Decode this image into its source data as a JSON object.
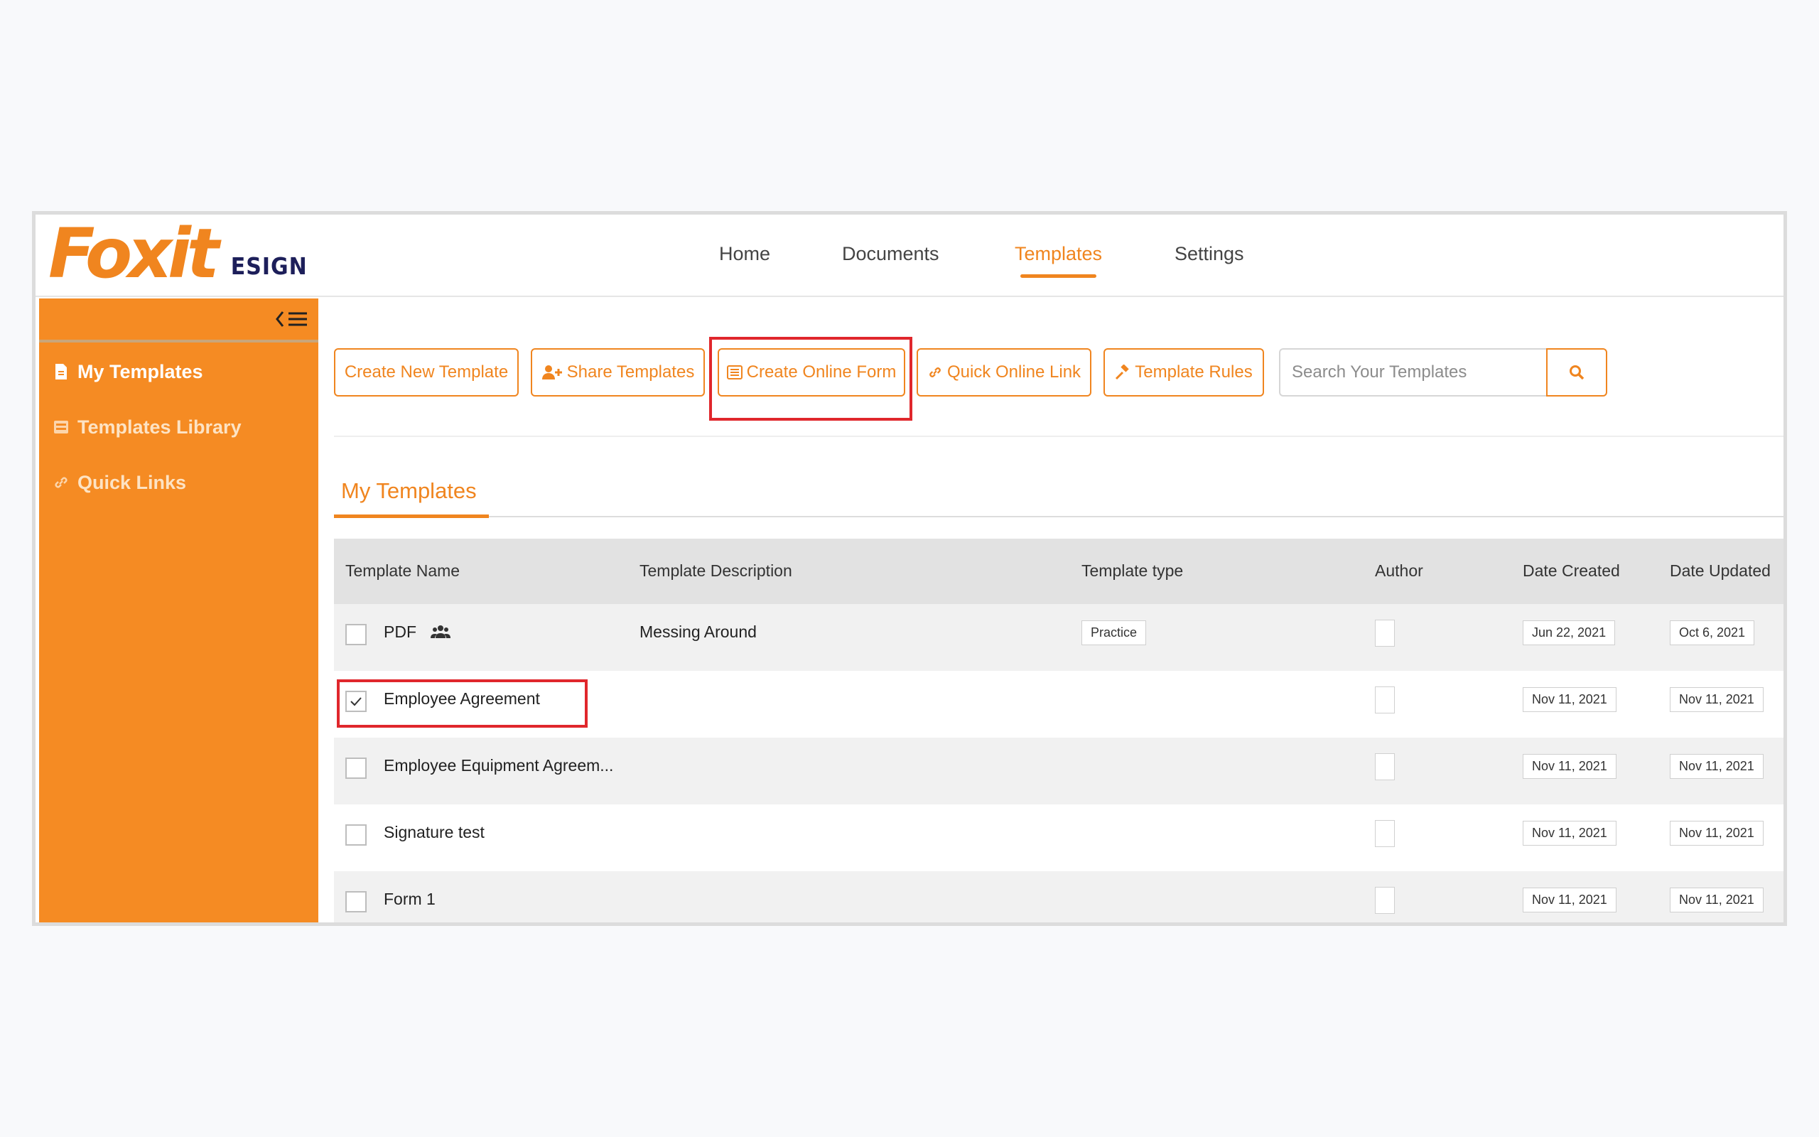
{
  "app": {
    "logo_word": "Foxit",
    "logo_suffix": "ESIGN"
  },
  "nav": {
    "items": [
      {
        "label": "Home",
        "active": false
      },
      {
        "label": "Documents",
        "active": false
      },
      {
        "label": "Templates",
        "active": true
      },
      {
        "label": "Settings",
        "active": false
      }
    ]
  },
  "sidebar": {
    "items": [
      {
        "label": "My Templates",
        "icon": "file-icon",
        "active": true
      },
      {
        "label": "Templates Library",
        "icon": "library-icon",
        "active": false
      },
      {
        "label": "Quick Links",
        "icon": "link-icon",
        "active": false
      }
    ]
  },
  "toolbar": {
    "create_new": "Create New Template",
    "share": "Share Templates",
    "create_form": "Create Online Form",
    "quick_link": "Quick Online Link",
    "rules": "Template Rules",
    "search_placeholder": "Search Your Templates"
  },
  "section": {
    "title": "My Templates"
  },
  "table": {
    "headers": {
      "name": "Template Name",
      "description": "Template Description",
      "type": "Template type",
      "author": "Author",
      "created": "Date Created",
      "updated": "Date Updated"
    },
    "rows": [
      {
        "name": "PDF",
        "shared": true,
        "description": "Messing Around",
        "type": "Practice",
        "checked": false,
        "created": "Jun 22, 2021",
        "updated": "Oct 6, 2021"
      },
      {
        "name": "Employee Agreement",
        "shared": false,
        "description": "",
        "type": "",
        "checked": true,
        "created": "Nov 11, 2021",
        "updated": "Nov 11, 2021"
      },
      {
        "name": "Employee Equipment Agreem...",
        "shared": false,
        "description": "",
        "type": "",
        "checked": false,
        "created": "Nov 11, 2021",
        "updated": "Nov 11, 2021"
      },
      {
        "name": "Signature test",
        "shared": false,
        "description": "",
        "type": "",
        "checked": false,
        "created": "Nov 11, 2021",
        "updated": "Nov 11, 2021"
      },
      {
        "name": "Form 1",
        "shared": false,
        "description": "",
        "type": "",
        "checked": false,
        "created": "Nov 11, 2021",
        "updated": "Nov 11, 2021"
      }
    ]
  },
  "colors": {
    "brand_orange": "#f0851f",
    "sidebar_orange": "#f58b23",
    "highlight_red": "#e0272c",
    "logo_navy": "#1d1f5a"
  }
}
